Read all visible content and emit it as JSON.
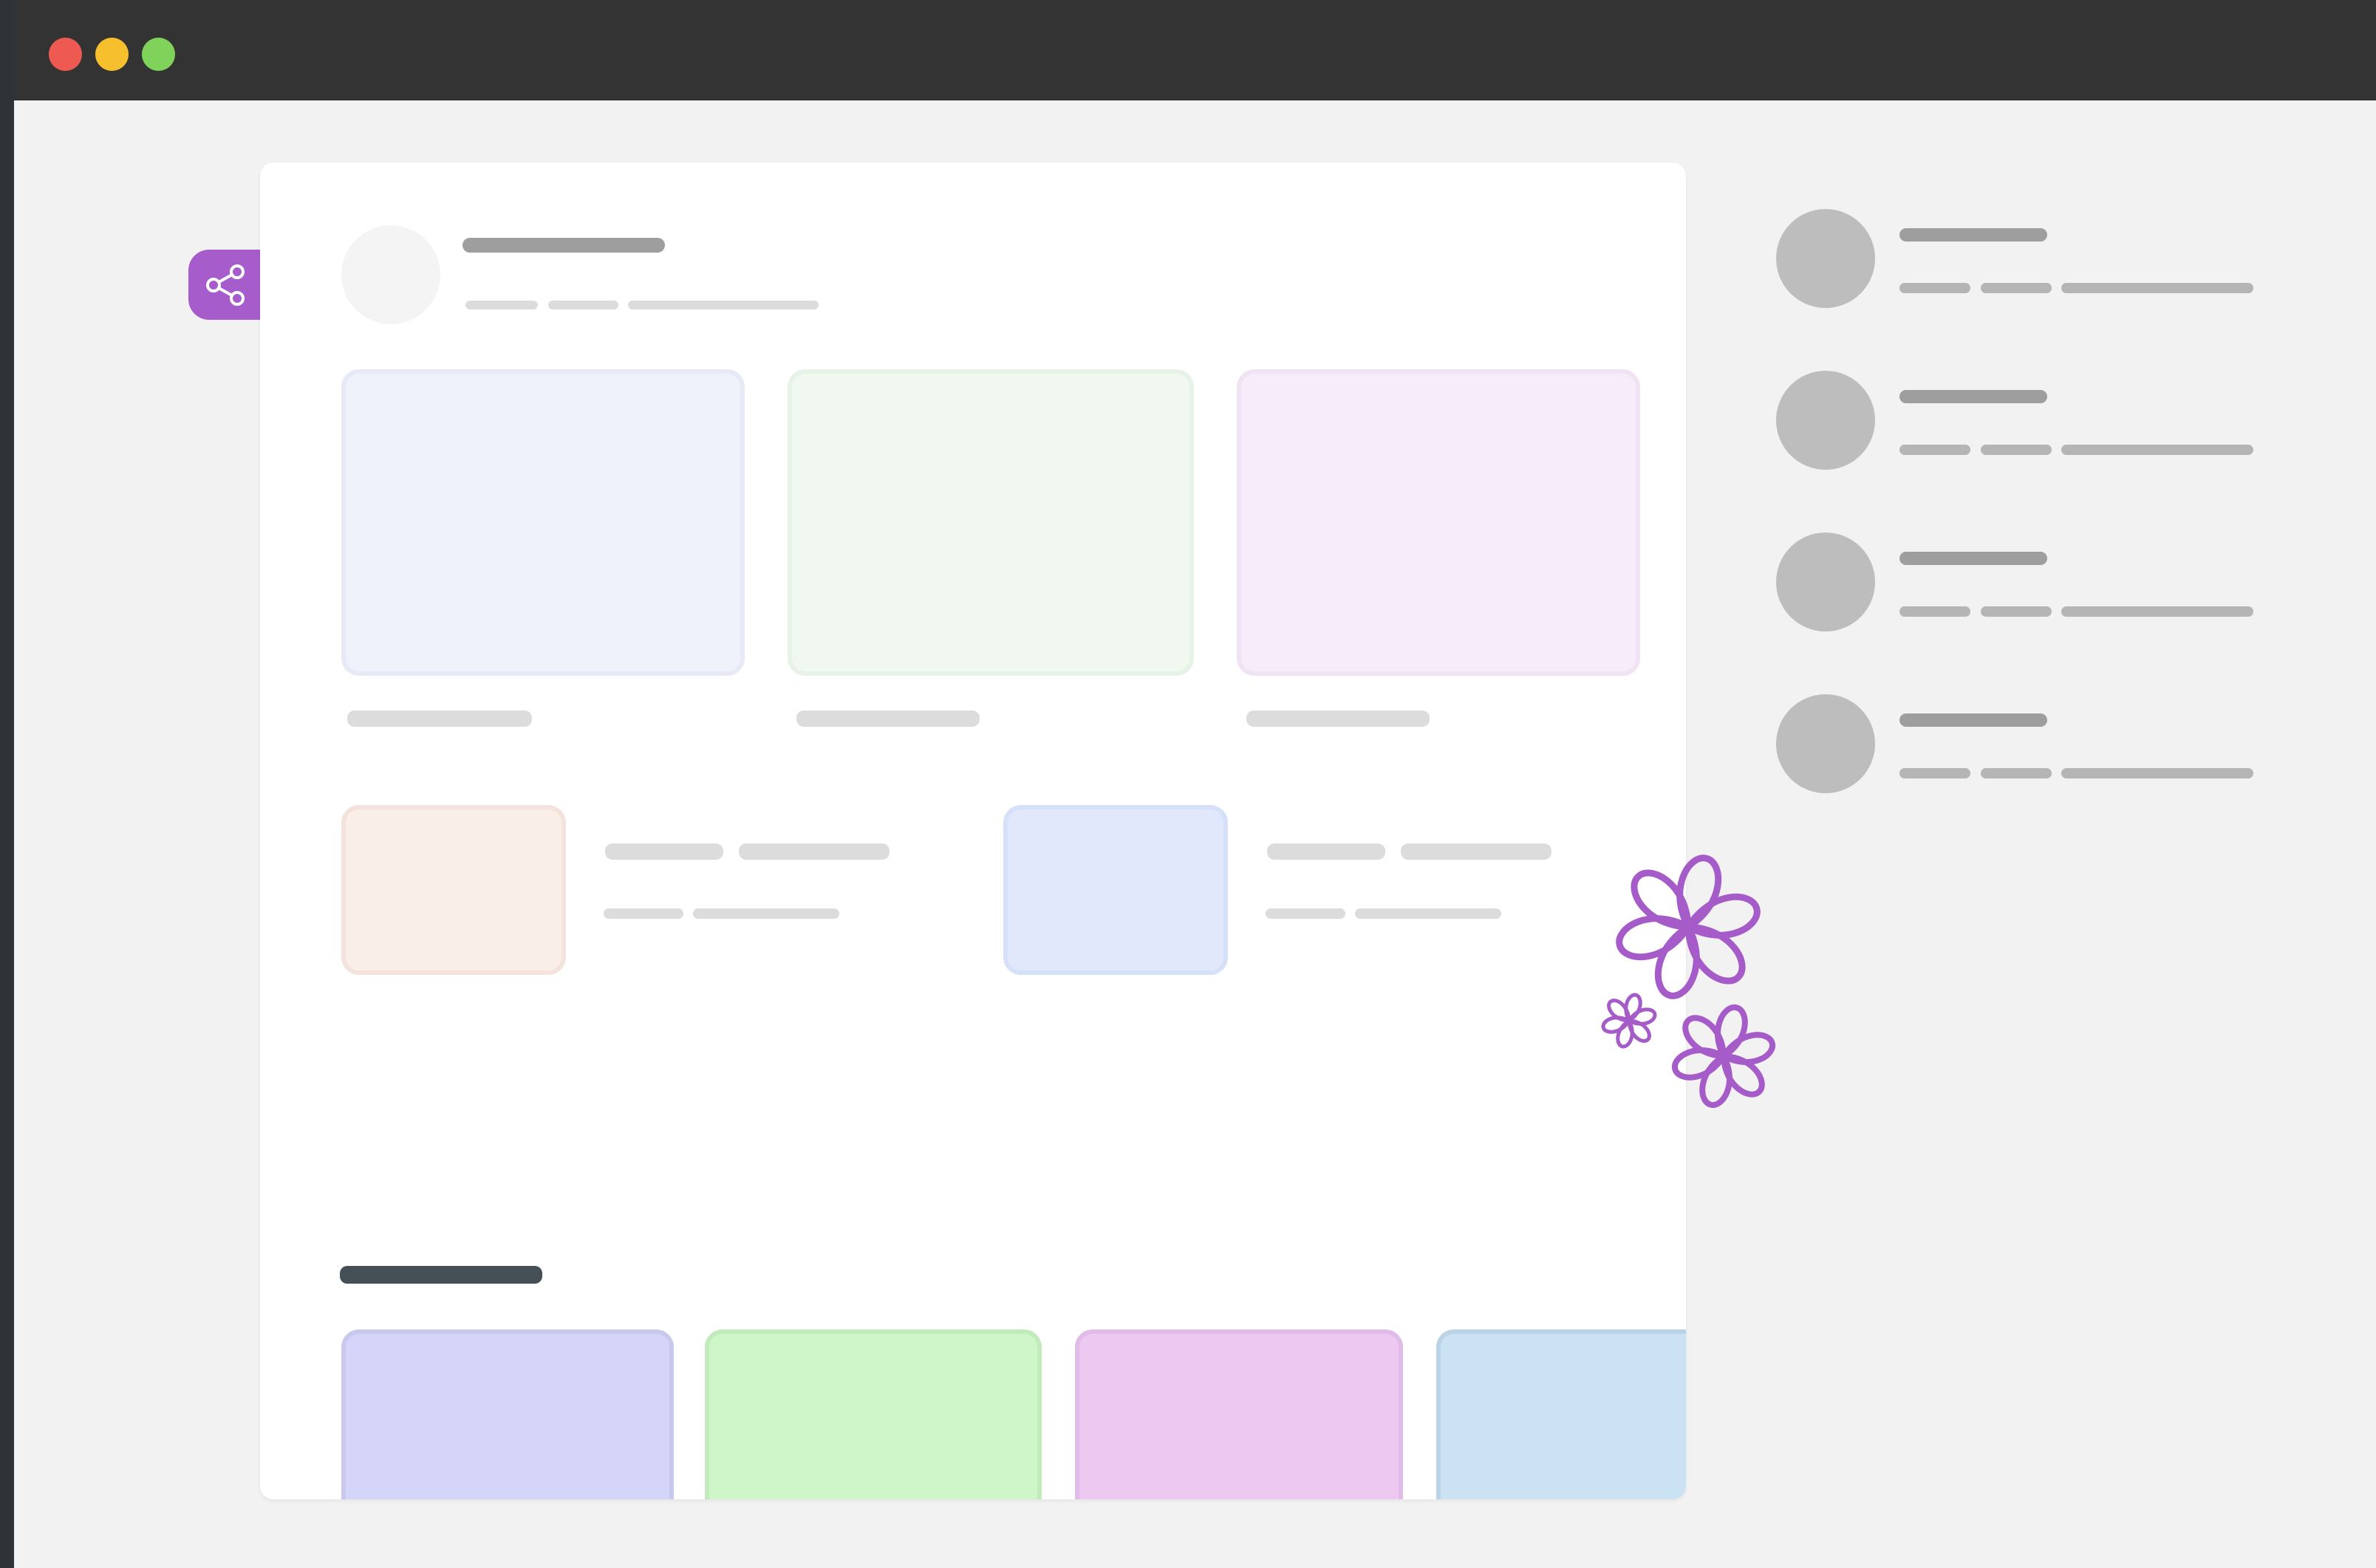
{
  "window": {
    "controls": [
      {
        "name": "close",
        "color": "#ee5a52"
      },
      {
        "name": "minimize",
        "color": "#f5bf2e"
      },
      {
        "name": "maximize",
        "color": "#7fd35a"
      }
    ]
  },
  "share_button": {
    "icon": "share-icon",
    "color": "#a75ccc"
  },
  "colors": {
    "skeleton_dark": "#9e9e9e",
    "skeleton_light": "#dcdcdc",
    "section_heading": "#455056",
    "flower": "#a55bc8"
  },
  "card_placeholders": [
    {
      "fill": "#eff1fb",
      "border": "#e7e9f6"
    },
    {
      "fill": "#f0f8ef",
      "border": "#e7f3e7"
    },
    {
      "fill": "#f7ecf9",
      "border": "#f0e3f4"
    }
  ],
  "small_tiles": [
    {
      "fill": "#faeee9",
      "border": "#f4e3dd"
    },
    {
      "fill": "#e1e8fb",
      "border": "#d6e0f7"
    }
  ],
  "bottom_tiles": [
    {
      "fill": "#d5d5f9",
      "border": "#c9c9ee"
    },
    {
      "fill": "#cff6c9",
      "border": "#c1ebbb"
    },
    {
      "fill": "#edc9f2",
      "border": "#e1bce8"
    },
    {
      "fill": "#cae2f2",
      "border": "#bad3e6"
    }
  ],
  "sidebar_items_count": 4,
  "decoration": {
    "icon": "flower-icon"
  }
}
